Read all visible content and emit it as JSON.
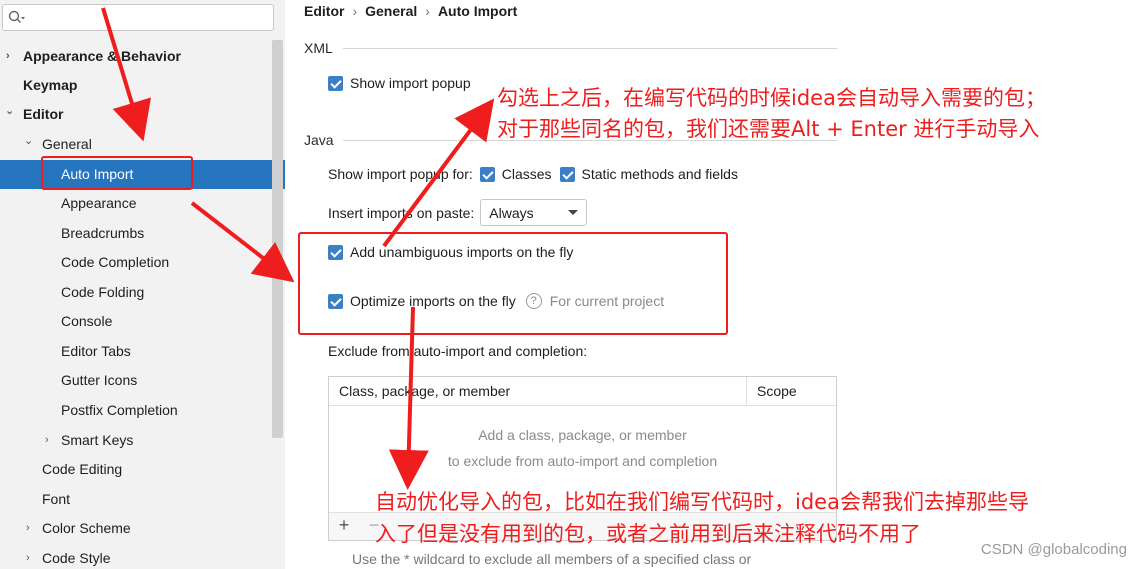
{
  "sidebar": {
    "search_placeholder": "",
    "items": [
      {
        "label": "Appearance & Behavior",
        "chevron": "›"
      },
      {
        "label": "Keymap",
        "chevron": ""
      },
      {
        "label": "Editor",
        "chevron": "⌄"
      },
      {
        "label": "General",
        "chevron": "⌄"
      },
      {
        "label": "Auto Import",
        "chevron": ""
      },
      {
        "label": "Appearance",
        "chevron": ""
      },
      {
        "label": "Breadcrumbs",
        "chevron": ""
      },
      {
        "label": "Code Completion",
        "chevron": ""
      },
      {
        "label": "Code Folding",
        "chevron": ""
      },
      {
        "label": "Console",
        "chevron": ""
      },
      {
        "label": "Editor Tabs",
        "chevron": ""
      },
      {
        "label": "Gutter Icons",
        "chevron": ""
      },
      {
        "label": "Postfix Completion",
        "chevron": ""
      },
      {
        "label": "Smart Keys",
        "chevron": "›"
      },
      {
        "label": "Code Editing",
        "chevron": ""
      },
      {
        "label": "Font",
        "chevron": ""
      },
      {
        "label": "Color Scheme",
        "chevron": "›"
      },
      {
        "label": "Code Style",
        "chevron": "›"
      }
    ],
    "selected": "Auto Import"
  },
  "breadcrumb": [
    "Editor",
    "General",
    "Auto Import"
  ],
  "breadcrumb_sep": "›",
  "xml": {
    "section": "XML",
    "show_popup_label": "Show import popup",
    "show_popup_checked": true
  },
  "java": {
    "section": "Java",
    "show_popup_for_label": "Show import popup for:",
    "classes_label": "Classes",
    "classes_checked": true,
    "static_label": "Static methods and fields",
    "static_checked": true,
    "insert_on_paste_label": "Insert imports on paste:",
    "insert_on_paste_value": "Always",
    "add_unambiguous_label": "Add unambiguous imports on the fly",
    "add_unambiguous_checked": true,
    "optimize_label": "Optimize imports on the fly",
    "optimize_checked": true,
    "optimize_hint": "For current project",
    "exclude_label": "Exclude from auto-import and completion:"
  },
  "exclude_table": {
    "columns": [
      "Class, package, or member",
      "Scope"
    ],
    "empty_line1": "Add a class, package, or member",
    "empty_line2": "to exclude from auto-import and completion",
    "add_btn": "+",
    "remove_btn": "−"
  },
  "wildcard_hint": "Use the * wildcard to exclude all members of a specified class or",
  "annotations": {
    "top_line1": "勾选上之后，在编写代码的时候idea会自动导入需要的包；",
    "top_line2": "对于那些同名的包，我们还需要Alt + Enter 进行手动导入",
    "bottom_line1": "自动优化导入的包，比如在我们编写代码时，idea会帮我们去掉那些导",
    "bottom_line2": "入了但是没有用到的包，或者之前用到后来注释代码不用了"
  },
  "watermark": "CSDN @globalcoding",
  "colors": {
    "selection": "#2675bf",
    "checkbox": "#3b7fc4",
    "annotation_red": "#ee1e1e"
  }
}
